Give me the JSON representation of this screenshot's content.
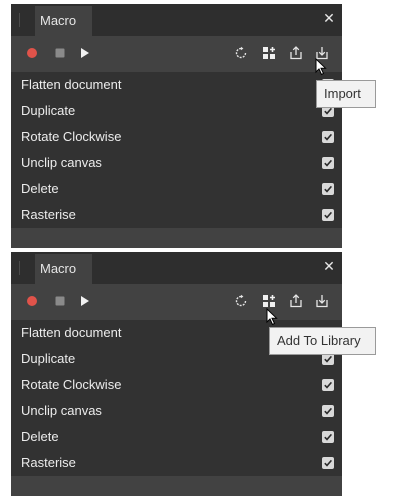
{
  "panels": [
    {
      "tab_label": "Macro",
      "close_glyph": "✕",
      "toolbar": [
        "record-icon",
        "stop-icon",
        "play-icon",
        "reset-icon",
        "add-to-library-icon",
        "export-icon",
        "import-icon"
      ],
      "items": [
        {
          "label": "Flatten document",
          "checked": true
        },
        {
          "label": "Duplicate",
          "checked": true
        },
        {
          "label": "Rotate Clockwise",
          "checked": true
        },
        {
          "label": "Unclip canvas",
          "checked": true
        },
        {
          "label": "Delete",
          "checked": true
        },
        {
          "label": "Rasterise",
          "checked": true
        }
      ],
      "tooltip": "Import"
    },
    {
      "tab_label": "Macro",
      "close_glyph": "✕",
      "toolbar": [
        "record-icon",
        "stop-icon",
        "play-icon",
        "reset-icon",
        "add-to-library-icon",
        "export-icon",
        "import-icon"
      ],
      "items": [
        {
          "label": "Flatten document",
          "checked": true
        },
        {
          "label": "Duplicate",
          "checked": true
        },
        {
          "label": "Rotate Clockwise",
          "checked": true
        },
        {
          "label": "Unclip canvas",
          "checked": true
        },
        {
          "label": "Delete",
          "checked": true
        },
        {
          "label": "Rasterise",
          "checked": true
        }
      ],
      "tooltip": "Add To Library"
    }
  ],
  "colors": {
    "panel_bg": "#424242",
    "tab_bar_bg": "#2e2e2e",
    "list_bg": "#323232",
    "record_red": "#e0534a",
    "text": "#ececec",
    "tooltip_bg": "#f2f2f2"
  }
}
